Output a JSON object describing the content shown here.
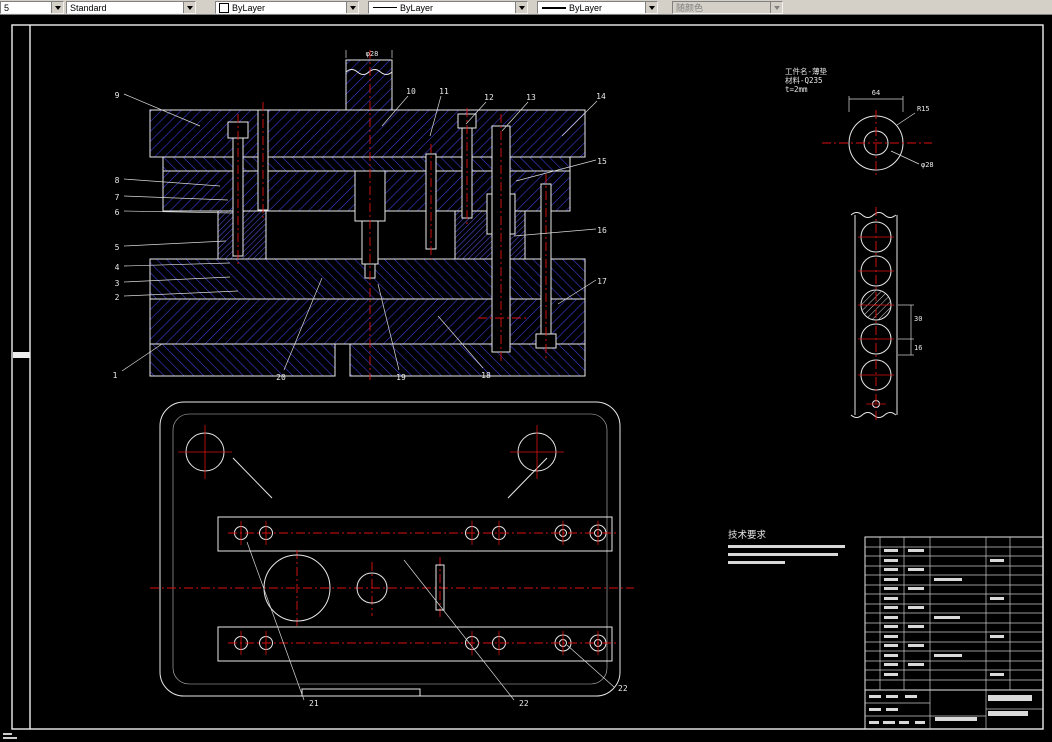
{
  "toolbar": {
    "dim_style_value": "5",
    "text_style_value": "Standard",
    "color_value": "ByLayer",
    "linetype_value": "ByLayer",
    "lineweight_value": "ByLayer",
    "plot_style_value": "随颜色"
  },
  "colors": {
    "canvas_background": "#000000",
    "geometry_line": "#e8e8e8",
    "centerline_red": "#dd1111",
    "hatch_blue": "#3c3cd8",
    "toolbar_gray": "#d4d0c8"
  },
  "drawing": {
    "balloons": {
      "n1": "1",
      "n2": "2",
      "n3": "3",
      "n4": "4",
      "n5": "5",
      "n6": "6",
      "n7": "7",
      "n8": "8",
      "n9": "9",
      "n10": "10",
      "n11": "11",
      "n12": "12",
      "n13": "13",
      "n14": "14",
      "n15": "15",
      "n16": "16",
      "n17": "17",
      "n18": "18",
      "n19": "19",
      "n20": "20",
      "n21": "21",
      "n22": "22"
    },
    "part_info": {
      "line1": "工件名-薄垫",
      "line2": "材料-Q235",
      "line3": "t=2mm"
    },
    "dims": {
      "shank_dia": "φ28",
      "width_64": "64",
      "radius": "R15",
      "hole_dia": "φ28",
      "strip_30": "30",
      "strip_16": "16"
    },
    "tech_req_title": "技术要求"
  }
}
